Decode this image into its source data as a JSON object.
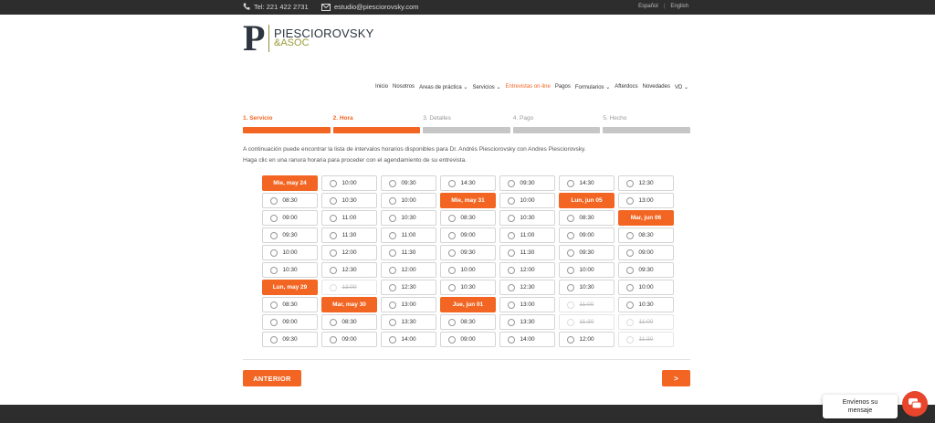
{
  "topbar": {
    "phone": "Tel: 221 422 2731",
    "email": "estudio@piesciorovsky.com",
    "lang_es": "Español",
    "lang_sep": "|",
    "lang_en": "English"
  },
  "logo": {
    "letter": "P",
    "name": "PIESCIOROVSKY",
    "sub": "&ASOC"
  },
  "nav": [
    {
      "label": "Inicio",
      "active": false
    },
    {
      "label": "Nosotros",
      "active": false
    },
    {
      "label": "Areas de práctica ⌄",
      "active": false
    },
    {
      "label": "Servicios ⌄",
      "active": false
    },
    {
      "label": "Entrevistas on-line",
      "active": true
    },
    {
      "label": "Pagos",
      "active": false
    },
    {
      "label": "Formularios ⌄",
      "active": false
    },
    {
      "label": "Afterdocs",
      "active": false
    },
    {
      "label": "Novedades",
      "active": false
    },
    {
      "label": "VD ⌄",
      "active": false
    }
  ],
  "steps": [
    {
      "label": "1. Servicio",
      "done": true
    },
    {
      "label": "2. Hora",
      "done": true
    },
    {
      "label": "3. Detalles",
      "done": false
    },
    {
      "label": "4. Pago",
      "done": false
    },
    {
      "label": "5. Hecho",
      "done": false
    }
  ],
  "description": {
    "line1": "A continuación puede encontrar la lista de intervalos horarios disponibles para Dr. Andrés Piesciorovsky con Andres Piesciorovsky.",
    "line2": "Haga clic en una ranura horaria para proceder con el agendamiento de su entrevista."
  },
  "columns": [
    [
      {
        "t": "Mie, may 24",
        "type": "date"
      },
      {
        "t": "08:30",
        "type": "slot"
      },
      {
        "t": "09:00",
        "type": "slot"
      },
      {
        "t": "09:30",
        "type": "slot"
      },
      {
        "t": "10:00",
        "type": "slot"
      },
      {
        "t": "10:30",
        "type": "slot"
      },
      {
        "t": "Lun, may 29",
        "type": "date"
      },
      {
        "t": "08:30",
        "type": "slot"
      },
      {
        "t": "09:00",
        "type": "slot"
      },
      {
        "t": "09:30",
        "type": "slot"
      }
    ],
    [
      {
        "t": "10:00",
        "type": "slot"
      },
      {
        "t": "10:30",
        "type": "slot"
      },
      {
        "t": "11:00",
        "type": "slot"
      },
      {
        "t": "11:30",
        "type": "slot"
      },
      {
        "t": "12:00",
        "type": "slot"
      },
      {
        "t": "12:30",
        "type": "slot"
      },
      {
        "t": "13:00",
        "type": "disabled"
      },
      {
        "t": "Mar, may 30",
        "type": "date"
      },
      {
        "t": "08:30",
        "type": "slot"
      },
      {
        "t": "09:00",
        "type": "slot"
      }
    ],
    [
      {
        "t": "09:30",
        "type": "slot"
      },
      {
        "t": "10:00",
        "type": "slot"
      },
      {
        "t": "10:30",
        "type": "slot"
      },
      {
        "t": "11:00",
        "type": "slot"
      },
      {
        "t": "11:30",
        "type": "slot"
      },
      {
        "t": "12:00",
        "type": "slot"
      },
      {
        "t": "12:30",
        "type": "slot"
      },
      {
        "t": "13:00",
        "type": "slot"
      },
      {
        "t": "13:30",
        "type": "slot"
      },
      {
        "t": "14:00",
        "type": "slot"
      }
    ],
    [
      {
        "t": "14:30",
        "type": "slot"
      },
      {
        "t": "Mie, may 31",
        "type": "date"
      },
      {
        "t": "08:30",
        "type": "slot"
      },
      {
        "t": "09:00",
        "type": "slot"
      },
      {
        "t": "09:30",
        "type": "slot"
      },
      {
        "t": "10:00",
        "type": "slot"
      },
      {
        "t": "10:30",
        "type": "slot"
      },
      {
        "t": "Jue, jun 01",
        "type": "date"
      },
      {
        "t": "08:30",
        "type": "slot"
      },
      {
        "t": "09:00",
        "type": "slot"
      }
    ],
    [
      {
        "t": "09:30",
        "type": "slot"
      },
      {
        "t": "10:00",
        "type": "slot"
      },
      {
        "t": "10:30",
        "type": "slot"
      },
      {
        "t": "11:00",
        "type": "slot"
      },
      {
        "t": "11:30",
        "type": "slot"
      },
      {
        "t": "12:00",
        "type": "slot"
      },
      {
        "t": "12:30",
        "type": "slot"
      },
      {
        "t": "13:00",
        "type": "slot"
      },
      {
        "t": "13:30",
        "type": "slot"
      },
      {
        "t": "14:00",
        "type": "slot"
      }
    ],
    [
      {
        "t": "14:30",
        "type": "slot"
      },
      {
        "t": "Lun, jun 05",
        "type": "date"
      },
      {
        "t": "08:30",
        "type": "slot"
      },
      {
        "t": "09:00",
        "type": "slot"
      },
      {
        "t": "09:30",
        "type": "slot"
      },
      {
        "t": "10:00",
        "type": "slot"
      },
      {
        "t": "10:30",
        "type": "slot"
      },
      {
        "t": "11:00",
        "type": "disabled"
      },
      {
        "t": "11:30",
        "type": "disabled"
      },
      {
        "t": "12:00",
        "type": "slot"
      }
    ],
    [
      {
        "t": "12:30",
        "type": "slot"
      },
      {
        "t": "13:00",
        "type": "slot"
      },
      {
        "t": "Mar, jun 06",
        "type": "date"
      },
      {
        "t": "08:30",
        "type": "slot"
      },
      {
        "t": "09:00",
        "type": "slot"
      },
      {
        "t": "09:30",
        "type": "slot"
      },
      {
        "t": "10:00",
        "type": "slot"
      },
      {
        "t": "10:30",
        "type": "slot"
      },
      {
        "t": "11:00",
        "type": "disabled"
      },
      {
        "t": "11:30",
        "type": "disabled"
      }
    ]
  ],
  "buttons": {
    "prev": "ANTERIOR",
    "next": ">"
  },
  "chat": {
    "line1": "Envíenos su",
    "line2": "mensaje"
  },
  "colors": {
    "accent": "#f26522",
    "dark_bar": "#2d2d2d",
    "logo_gold": "#9c9c3a"
  }
}
